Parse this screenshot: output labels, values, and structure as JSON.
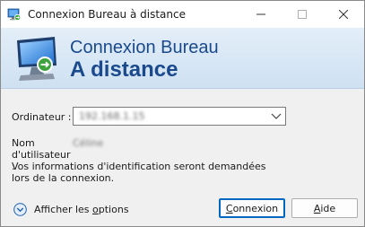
{
  "window": {
    "title": "Connexion Bureau à distance"
  },
  "banner": {
    "line1": "Connexion Bureau",
    "line2": "A distance"
  },
  "form": {
    "computer_label": "Ordinateur :",
    "computer_value": "192.168.1.15",
    "user_label": "Nom d'utilisateur :",
    "user_value": "Céline",
    "info": "Vos informations d'identification seront demandées lors de la connexion."
  },
  "footer": {
    "options_label_pre": "Afficher les ",
    "options_label_u": "o",
    "options_label_post": "ptions",
    "connect_pre": "",
    "connect_u": "C",
    "connect_post": "onnexion",
    "help_pre": "",
    "help_u": "A",
    "help_post": "ide"
  },
  "icons": {
    "app": "remote-desktop-icon",
    "minimize": "minimize-icon",
    "maximize": "maximize-icon",
    "close": "close-icon",
    "dropdown": "chevron-down-icon",
    "options": "expand-circle-icon",
    "banner": "remote-desktop-monitor-icon"
  },
  "colors": {
    "accent": "#0067c0",
    "banner_text": "#1a4a8c"
  }
}
